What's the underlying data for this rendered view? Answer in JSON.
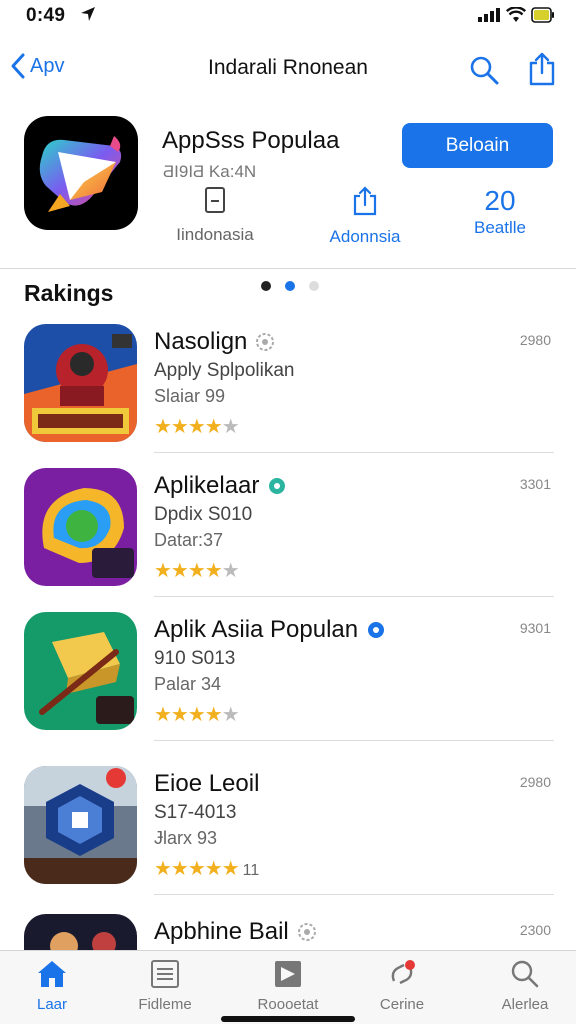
{
  "status_bar": {
    "time": "0:49"
  },
  "nav": {
    "back_label": "Apv",
    "title": "Indarali Rnonean"
  },
  "app": {
    "name": "AppSss Populaa",
    "subtitle": "ƋI9IƋ Ka:4N",
    "get_label": "Beloain",
    "meta": [
      {
        "label": "Iindonasia",
        "icon": "device-icon"
      },
      {
        "label": "Adonnsia",
        "icon": "share-icon"
      },
      {
        "value": "20",
        "label": "Beatlle"
      }
    ]
  },
  "rankings": {
    "title": "Rakings",
    "page_dots": {
      "count": 3,
      "active": 1
    },
    "items": [
      {
        "name": "Nasolign",
        "line2": "Apply Splpolikan",
        "line3": "Slaiar 99",
        "rating": 3.5,
        "rating_count": "",
        "number": "2980",
        "badge": "gray"
      },
      {
        "name": "Aplikelaar",
        "line2": "Dpdix S010",
        "line3": "Datar:37",
        "rating": 3.5,
        "rating_count": "",
        "number": "3301",
        "badge": "teal"
      },
      {
        "name": "Aplik Asiia Populan",
        "line2": "910 S013",
        "line3": "Palar 34",
        "rating": 3.5,
        "rating_count": "",
        "number": "9301",
        "badge": "blue"
      },
      {
        "name": "Eioe Leoil",
        "line2": "S17-4013",
        "line3": "Ɉlarx 93",
        "rating": 4.5,
        "rating_count": "11",
        "number": "2980",
        "badge": "none"
      },
      {
        "name": "Apbhine Bail",
        "line2": "",
        "line3": "",
        "rating": 0,
        "rating_count": "",
        "number": "2300",
        "badge": "gray"
      }
    ]
  },
  "tabs": [
    {
      "label": "Laar",
      "icon": "home-icon",
      "active": true
    },
    {
      "label": "Fidleme",
      "icon": "list-icon",
      "active": false
    },
    {
      "label": "Roooetat",
      "icon": "media-icon",
      "active": false
    },
    {
      "label": "Cerine",
      "icon": "sync-icon",
      "active": false
    },
    {
      "label": "Alerlea",
      "icon": "search-icon",
      "active": false
    }
  ],
  "colors": {
    "accent": "#1a73e8",
    "star": "#f2b01e",
    "get_button": "#1a73e8"
  }
}
